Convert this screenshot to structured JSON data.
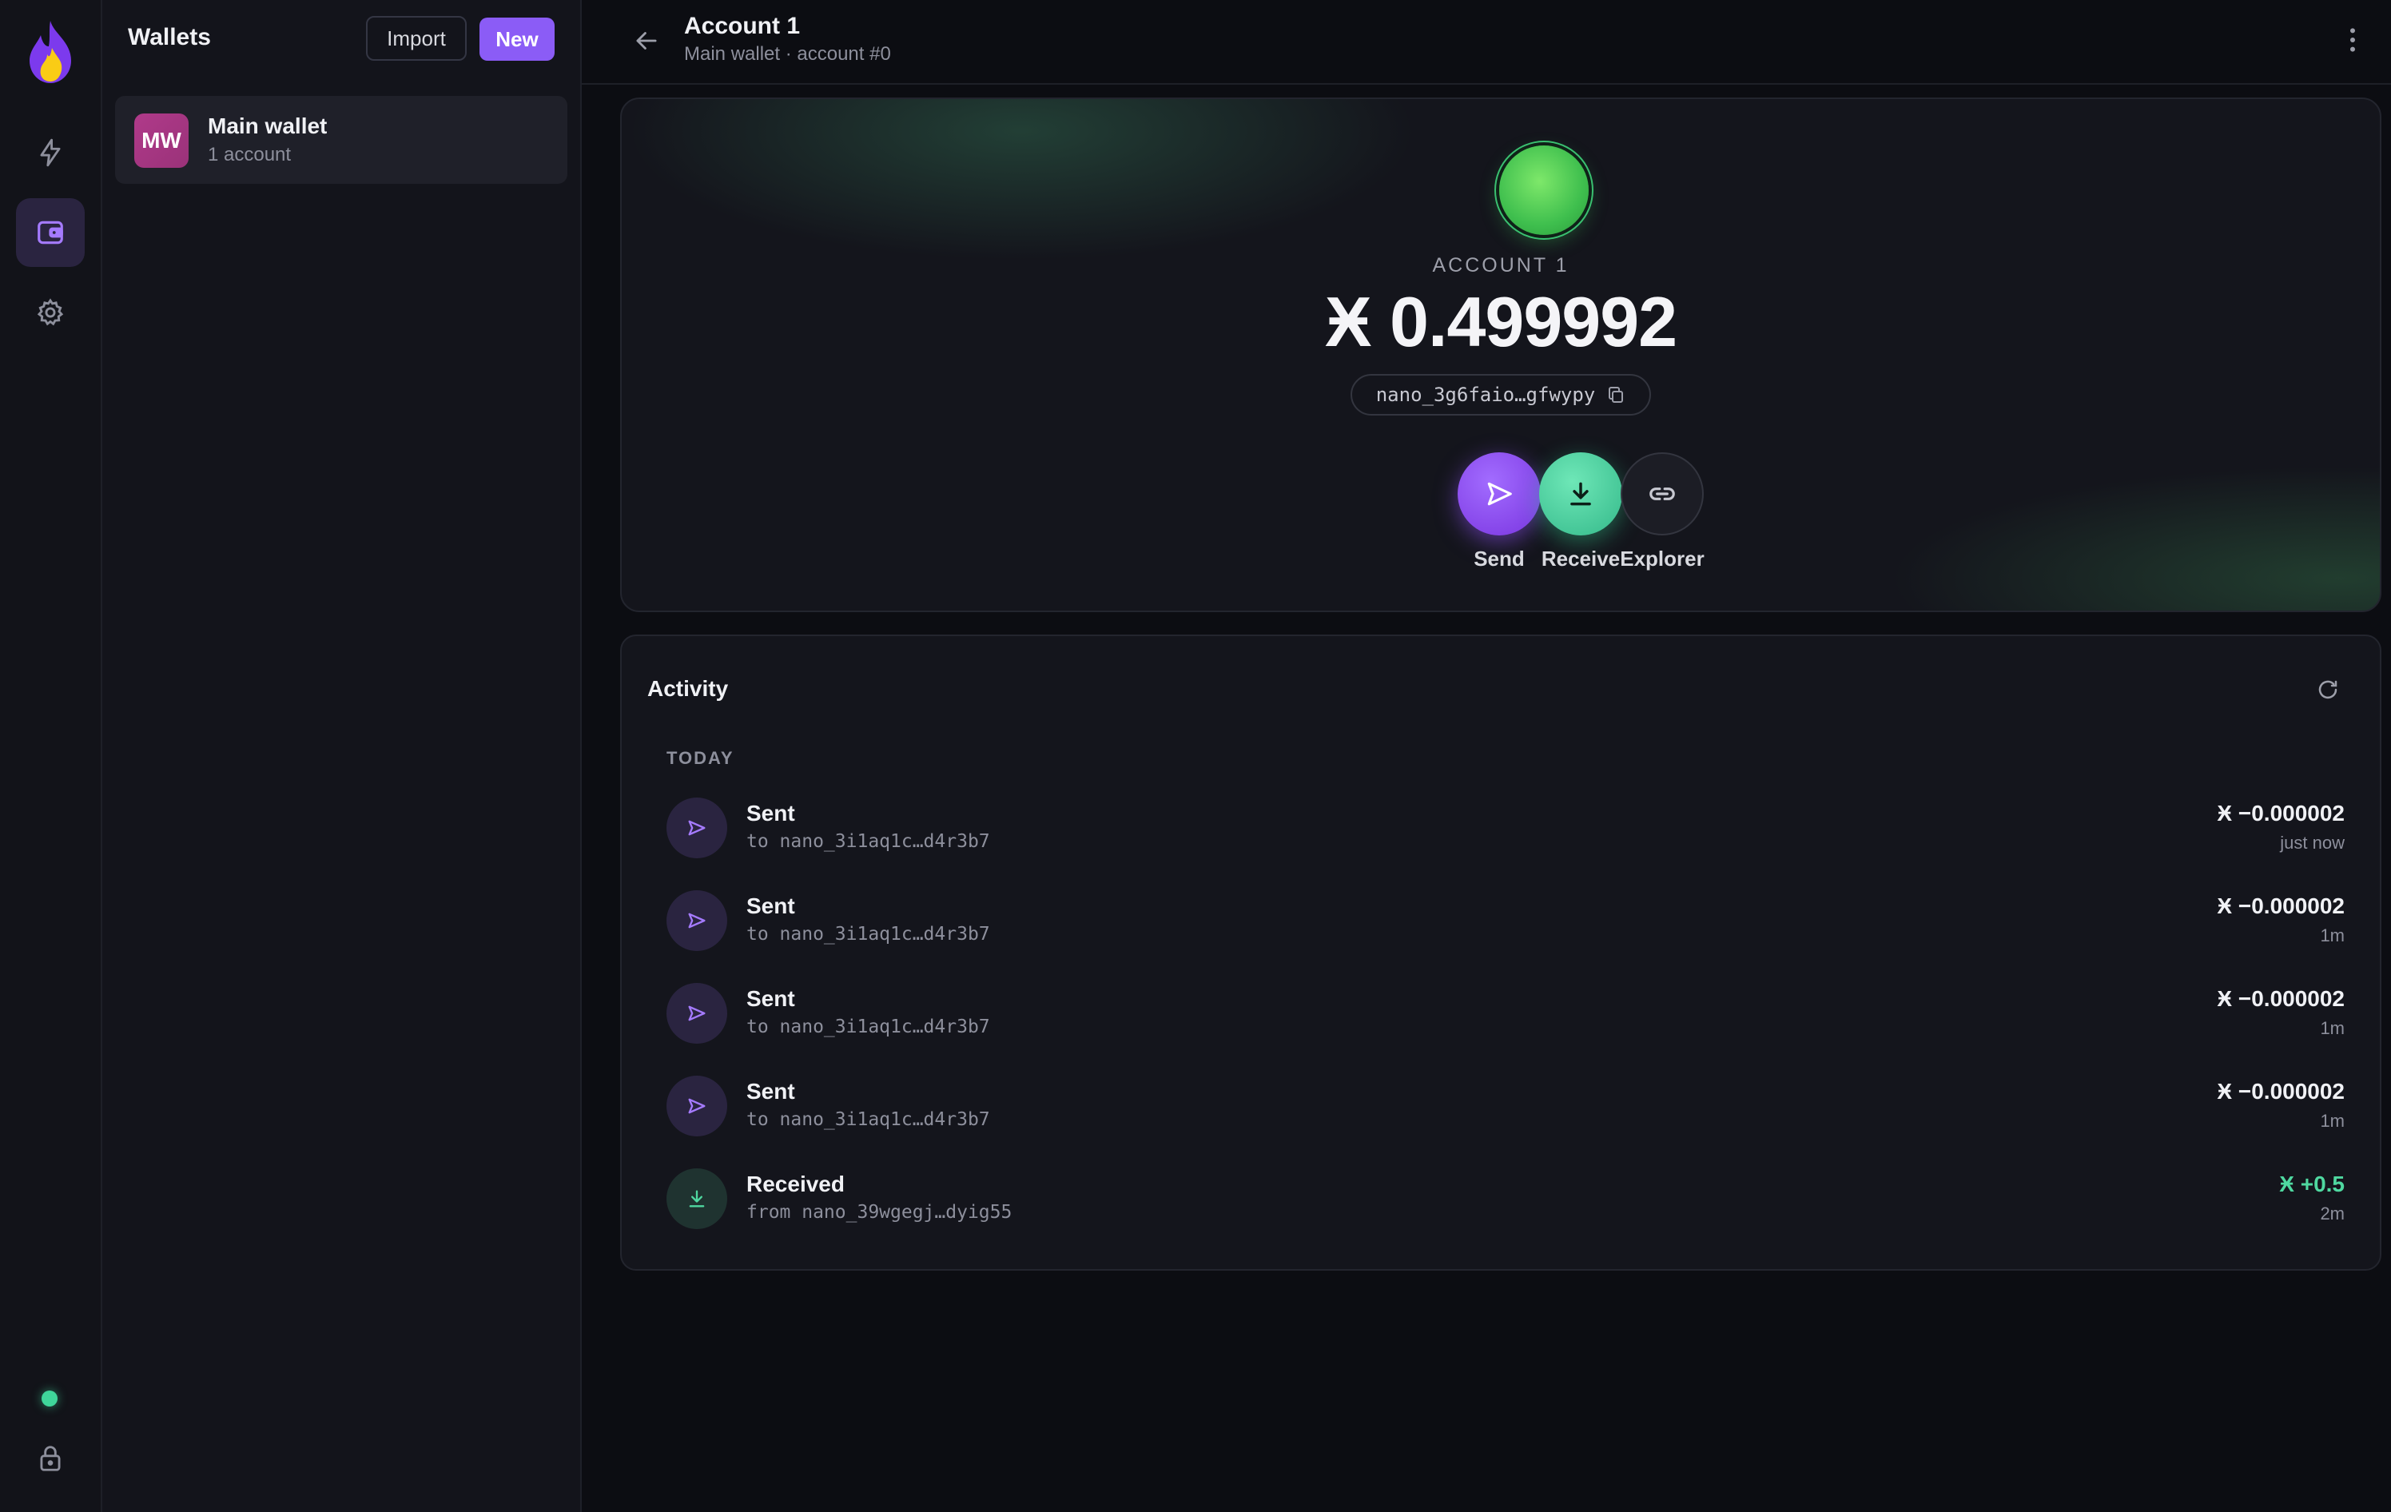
{
  "colors": {
    "accent": "#8b5cf6",
    "success": "#3fd69a",
    "background": "#0c0d12"
  },
  "rail": {
    "items": [
      {
        "name": "lightning-icon"
      },
      {
        "name": "wallet-icon",
        "active": true
      },
      {
        "name": "gear-icon"
      }
    ],
    "bottom": [
      "status-dot",
      "lock-icon"
    ]
  },
  "wallets_panel": {
    "title": "Wallets",
    "import_label": "Import",
    "new_label": "New",
    "items": [
      {
        "initials": "MW",
        "name": "Main wallet",
        "sub": "1 account"
      }
    ]
  },
  "header": {
    "title": "Account 1",
    "subtitle": "Main wallet · account #0"
  },
  "hero": {
    "account_label": "ACCOUNT 1",
    "balance": "Ӿ 0.499992",
    "address": "nano_3g6faio…gfwypy",
    "actions": {
      "send": "Send",
      "receive": "Receive",
      "explorer": "Explorer"
    }
  },
  "activity": {
    "title": "Activity",
    "group_label": "TODAY",
    "transactions": [
      {
        "type": "Sent",
        "peer": "to nano_3i1aq1c…d4r3b7",
        "amount": "Ӿ −0.000002",
        "time": "just now",
        "direction": "out"
      },
      {
        "type": "Sent",
        "peer": "to nano_3i1aq1c…d4r3b7",
        "amount": "Ӿ −0.000002",
        "time": "1m",
        "direction": "out"
      },
      {
        "type": "Sent",
        "peer": "to nano_3i1aq1c…d4r3b7",
        "amount": "Ӿ −0.000002",
        "time": "1m",
        "direction": "out"
      },
      {
        "type": "Sent",
        "peer": "to nano_3i1aq1c…d4r3b7",
        "amount": "Ӿ −0.000002",
        "time": "1m",
        "direction": "out"
      },
      {
        "type": "Received",
        "peer": "from nano_39wgegj…dyig55",
        "amount": "Ӿ +0.5",
        "time": "2m",
        "direction": "in"
      }
    ]
  }
}
